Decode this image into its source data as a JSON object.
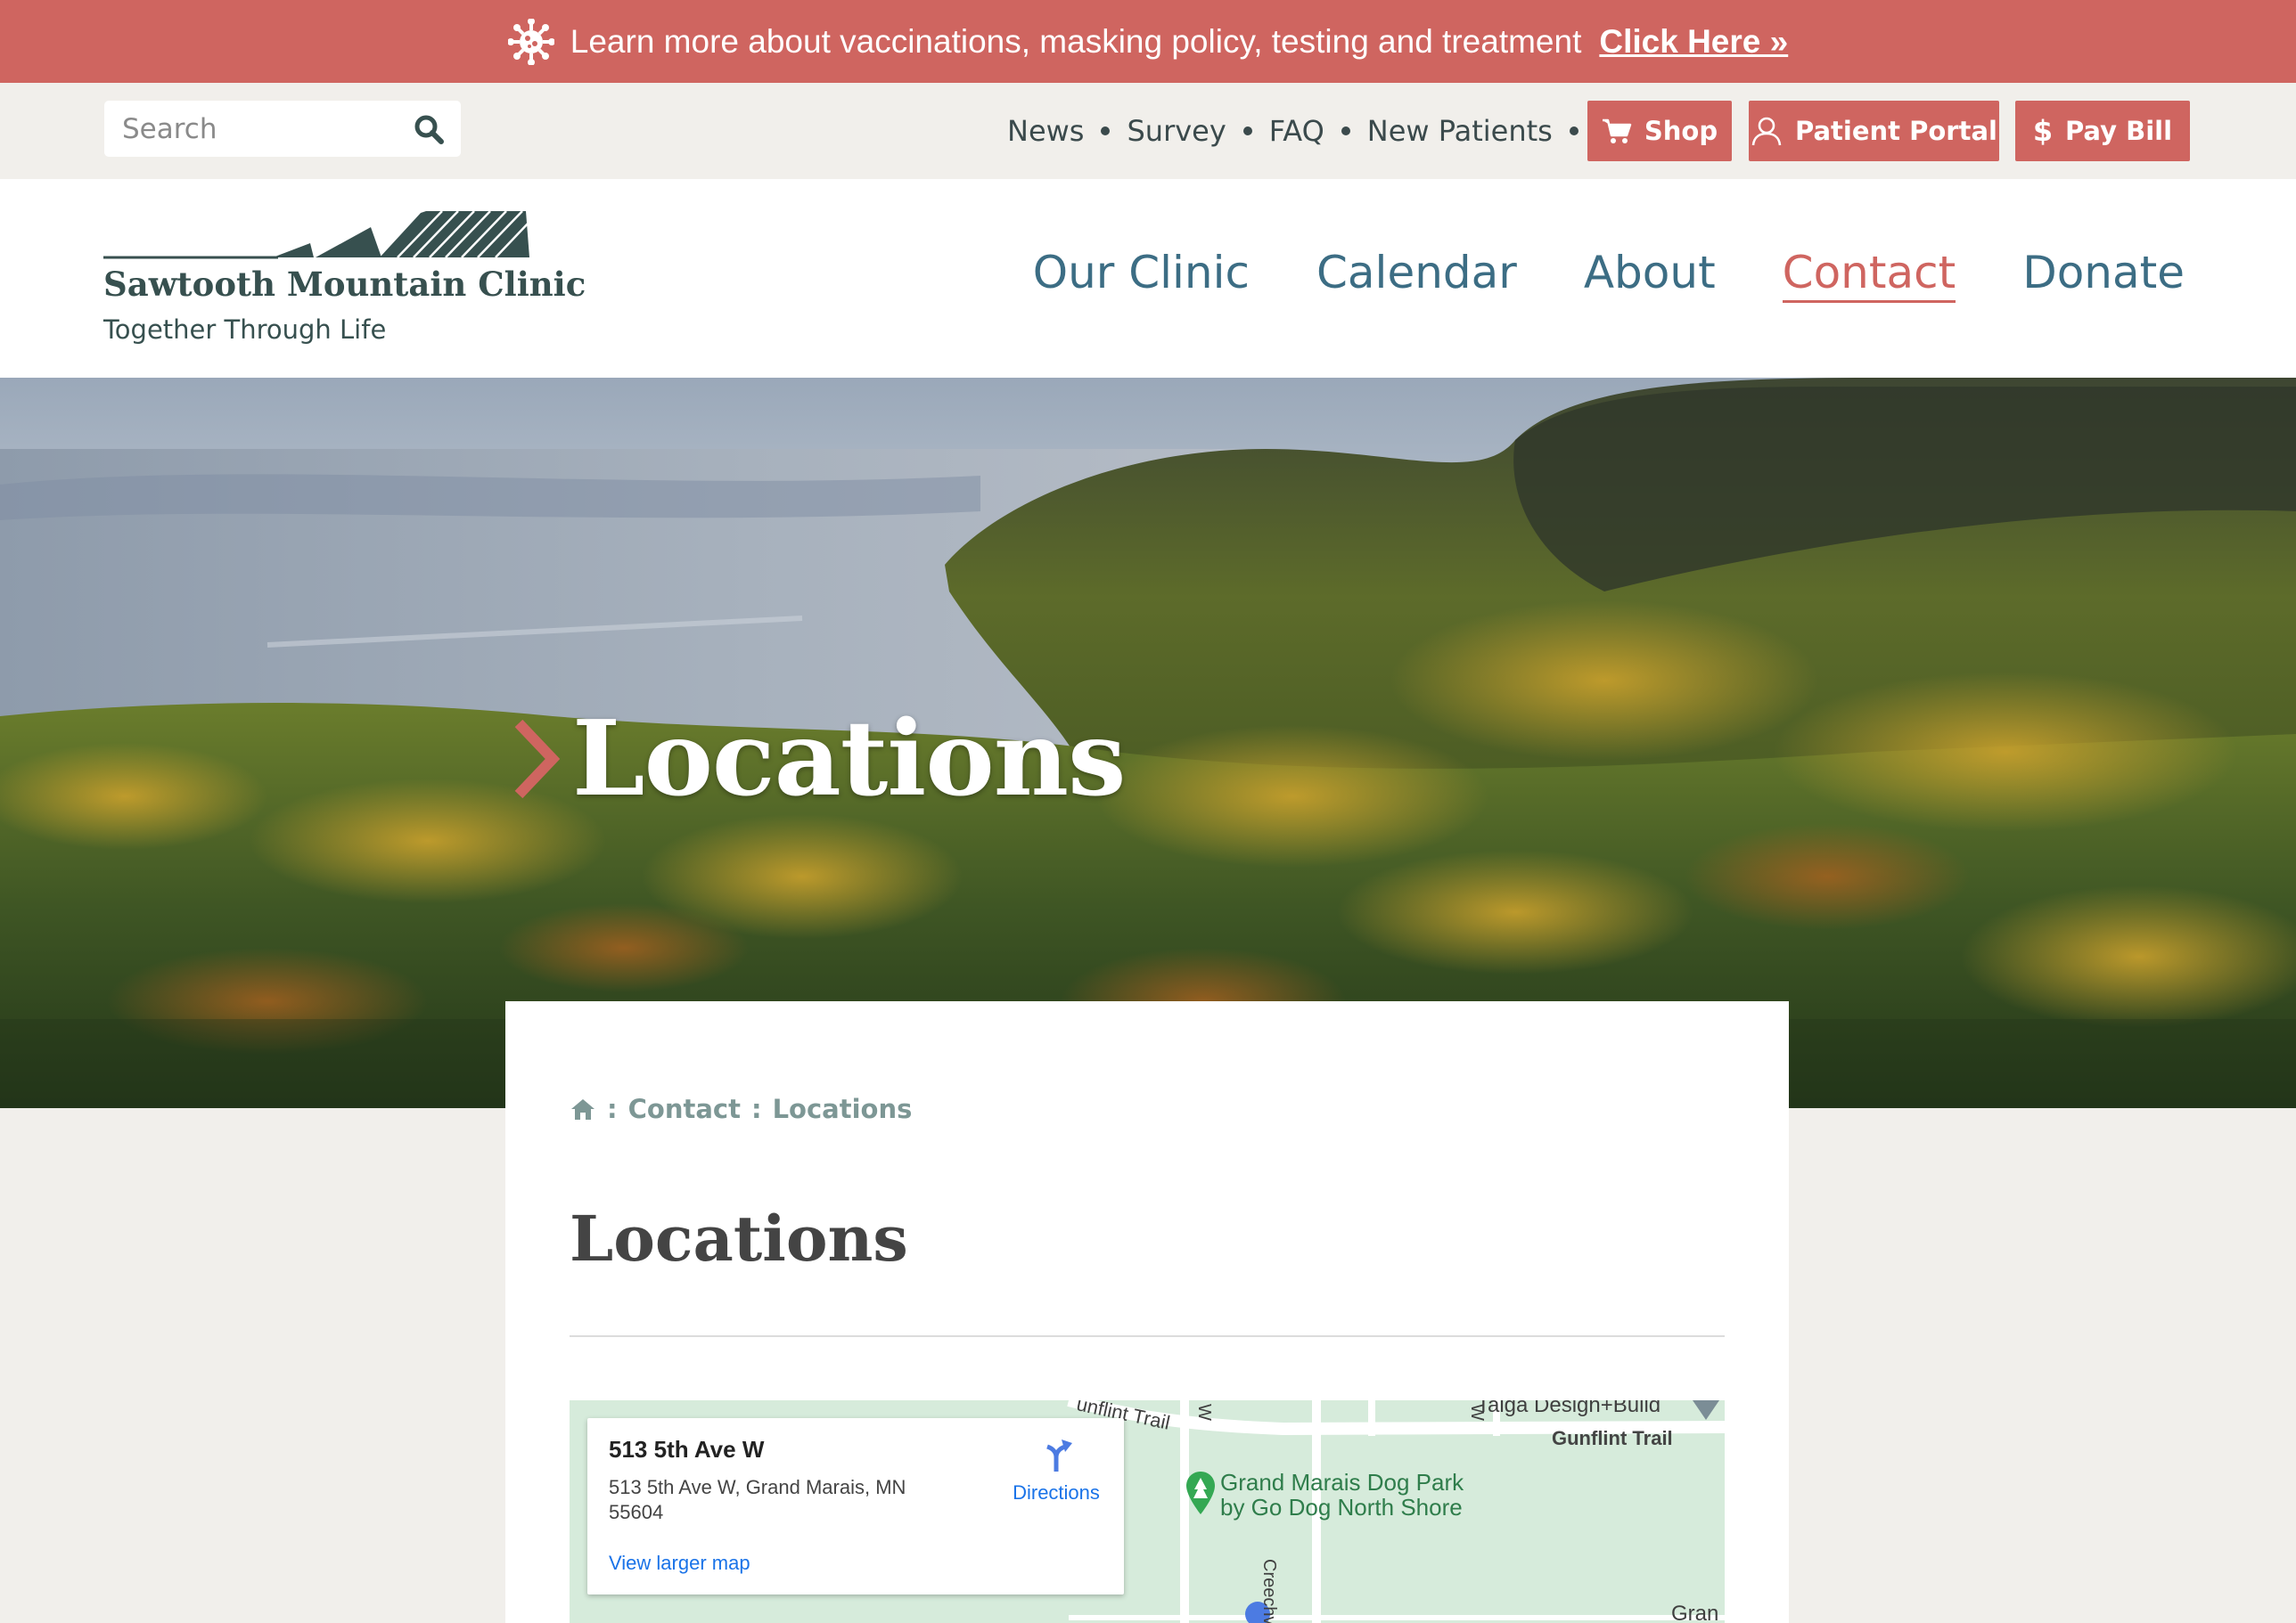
{
  "alert": {
    "message": "Learn more about vaccinations, masking policy, testing and treatment",
    "link_label": "Click Here »",
    "icon": "virus-icon"
  },
  "utility": {
    "search_placeholder": "Search",
    "links": [
      "News",
      "Survey",
      "FAQ",
      "New Patients"
    ],
    "shop_label": "Shop",
    "portal_label": "Patient Portal",
    "pay_label": "Pay Bill"
  },
  "header": {
    "clinic_name": "Sawtooth Mountain Clinic",
    "tagline": "Together Through Life",
    "nav": [
      "Our Clinic",
      "Calendar",
      "About",
      "Contact",
      "Donate"
    ],
    "active_nav": "Contact"
  },
  "hero": {
    "title": "Locations"
  },
  "content": {
    "breadcrumb": [
      "Contact",
      "Locations"
    ],
    "page_title": "Locations"
  },
  "map": {
    "place_title": "513 5th Ave W",
    "place_address": "513 5th Ave W, Grand Marais, MN 55604",
    "directions_label": "Directions",
    "larger_map_label": "View larger map",
    "labels": {
      "gunflint_trail_top": "unflint Trail",
      "gunflint_trail": "Gunflint Trail",
      "taiga": "Taiga Design+Build",
      "dog_park": "Grand Marais Dog Park\nby Go Dog North Shore",
      "creechville": "Creechvil",
      "gran": "Gran",
      "w1": "W",
      "w2": "W"
    }
  },
  "colors": {
    "accent": "#cf6560",
    "nav_blue": "#3c6d84",
    "brand_dark": "#37504f",
    "map_green": "#d6ebdb"
  }
}
